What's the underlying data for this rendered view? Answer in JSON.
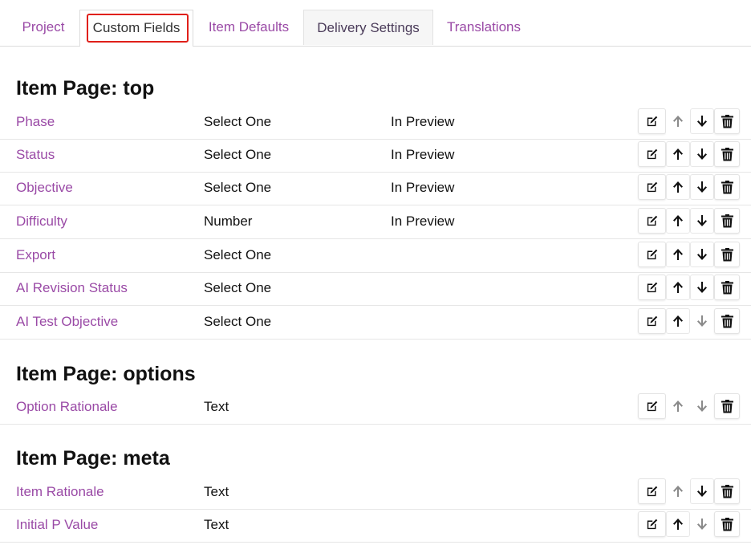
{
  "tabs": [
    {
      "label": "Project"
    },
    {
      "label": "Custom Fields"
    },
    {
      "label": "Item Defaults"
    },
    {
      "label": "Delivery Settings"
    },
    {
      "label": "Translations"
    }
  ],
  "sections": [
    {
      "title": "Item Page: top",
      "rows": [
        {
          "name": "Phase",
          "type": "Select One",
          "preview": "In Preview",
          "up_enabled": false,
          "down_enabled": true
        },
        {
          "name": "Status",
          "type": "Select One",
          "preview": "In Preview",
          "up_enabled": true,
          "down_enabled": true
        },
        {
          "name": "Objective",
          "type": "Select One",
          "preview": "In Preview",
          "up_enabled": true,
          "down_enabled": true
        },
        {
          "name": "Difficulty",
          "type": "Number",
          "preview": "In Preview",
          "up_enabled": true,
          "down_enabled": true
        },
        {
          "name": "Export",
          "type": "Select One",
          "preview": "",
          "up_enabled": true,
          "down_enabled": true
        },
        {
          "name": "AI Revision Status",
          "type": "Select One",
          "preview": "",
          "up_enabled": true,
          "down_enabled": true
        },
        {
          "name": "AI Test Objective",
          "type": "Select One",
          "preview": "",
          "up_enabled": true,
          "down_enabled": false
        }
      ]
    },
    {
      "title": "Item Page: options",
      "rows": [
        {
          "name": "Option Rationale",
          "type": "Text",
          "preview": "",
          "up_enabled": false,
          "down_enabled": false
        }
      ]
    },
    {
      "title": "Item Page: meta",
      "rows": [
        {
          "name": "Item Rationale",
          "type": "Text",
          "preview": "",
          "up_enabled": false,
          "down_enabled": true
        },
        {
          "name": "Initial P Value",
          "type": "Text",
          "preview": "",
          "up_enabled": true,
          "down_enabled": false
        }
      ]
    }
  ],
  "icons": {
    "edit": "edit-icon",
    "up": "arrow-up-icon",
    "down": "arrow-down-icon",
    "delete": "trash-icon"
  },
  "colors": {
    "link": "#9a4aa6",
    "highlight": "#e0201a",
    "disabled_arrow": "#8a8a8a"
  }
}
